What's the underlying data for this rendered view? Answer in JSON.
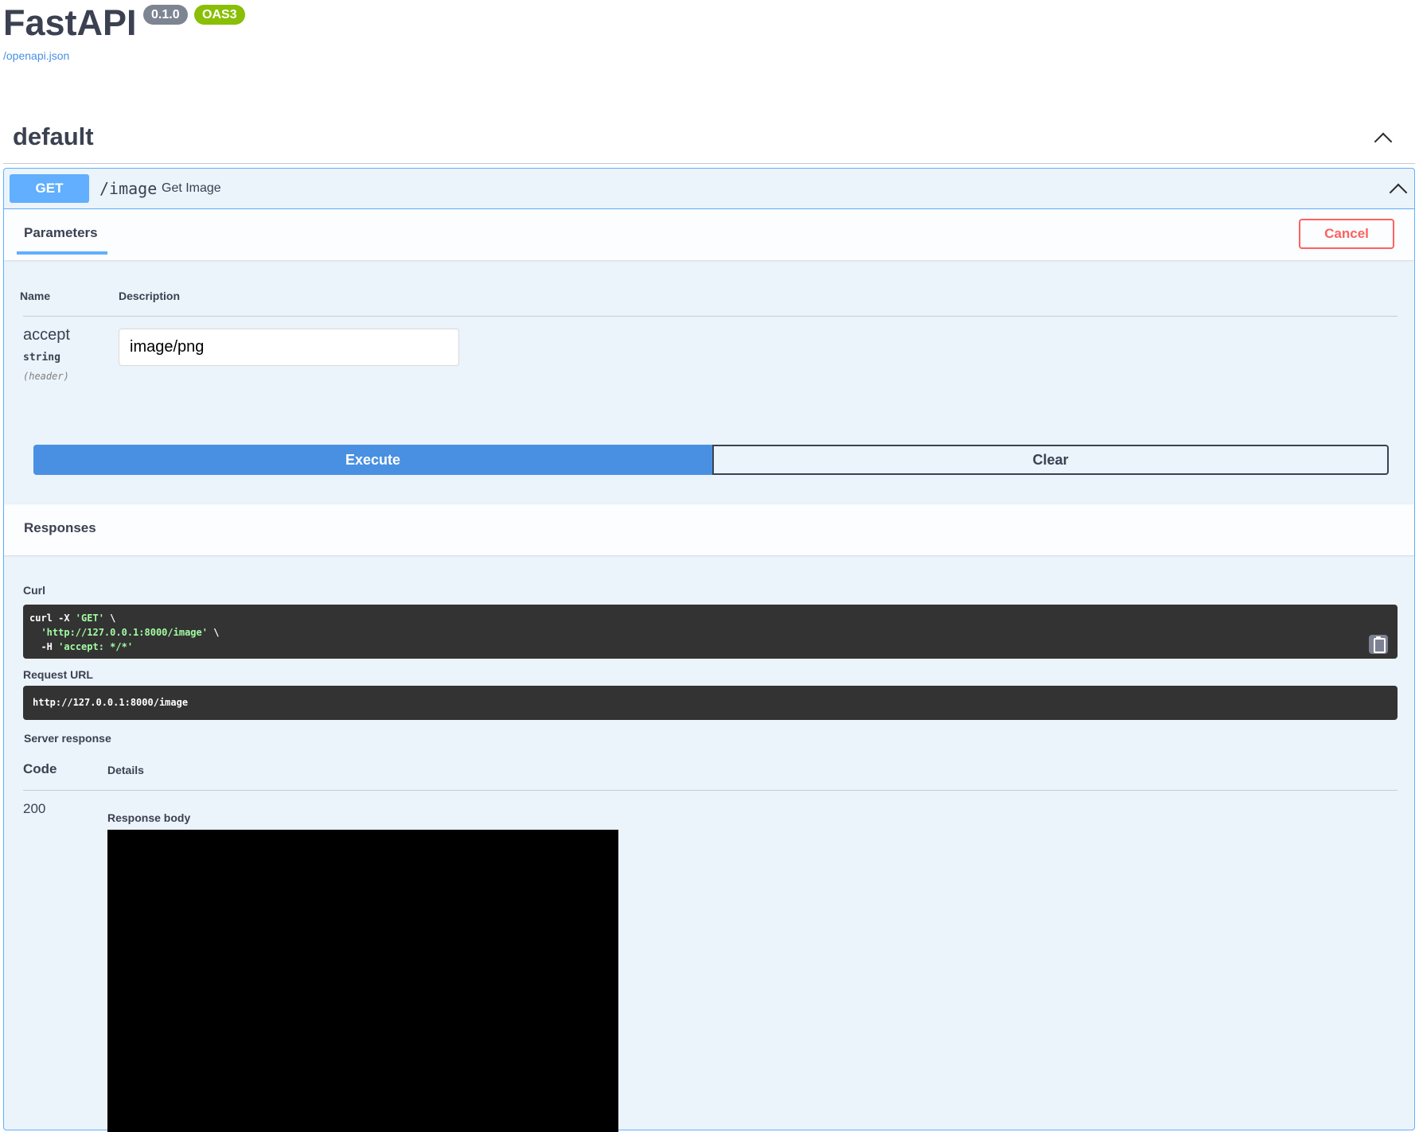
{
  "info": {
    "title": "FastAPI",
    "version": "0.1.0",
    "oas_badge": "OAS3",
    "spec_link": "/openapi.json"
  },
  "tag": {
    "name": "default"
  },
  "operation": {
    "method": "GET",
    "path": "/image",
    "summary": "Get Image",
    "tab_label": "Parameters",
    "cancel_label": "Cancel",
    "columns": {
      "name": "Name",
      "description": "Description"
    },
    "parameter": {
      "name": "accept",
      "type": "string",
      "location": "(header)",
      "value": "image/png"
    },
    "execute_label": "Execute",
    "clear_label": "Clear"
  },
  "responses": {
    "title": "Responses",
    "curl_label": "Curl",
    "curl_lines": {
      "l1_cmd": "curl -X ",
      "l1_str": "'GET'",
      "l1_end": " \\",
      "l2_str": "'http://127.0.0.1:8000/image'",
      "l2_end": " \\",
      "l3_cmd": "-H ",
      "l3_str": "'accept: */*'"
    },
    "request_url_label": "Request URL",
    "request_url": "http://127.0.0.1:8000/image",
    "server_response_label": "Server response",
    "code_header": "Code",
    "details_header": "Details",
    "status_code": "200",
    "response_body_label": "Response body"
  },
  "colors": {
    "get_blue": "#61affe",
    "execute_blue": "#4990e2",
    "cancel_red": "#ff6060",
    "version_gray": "#7d8492",
    "oas_green": "#89bf04"
  }
}
